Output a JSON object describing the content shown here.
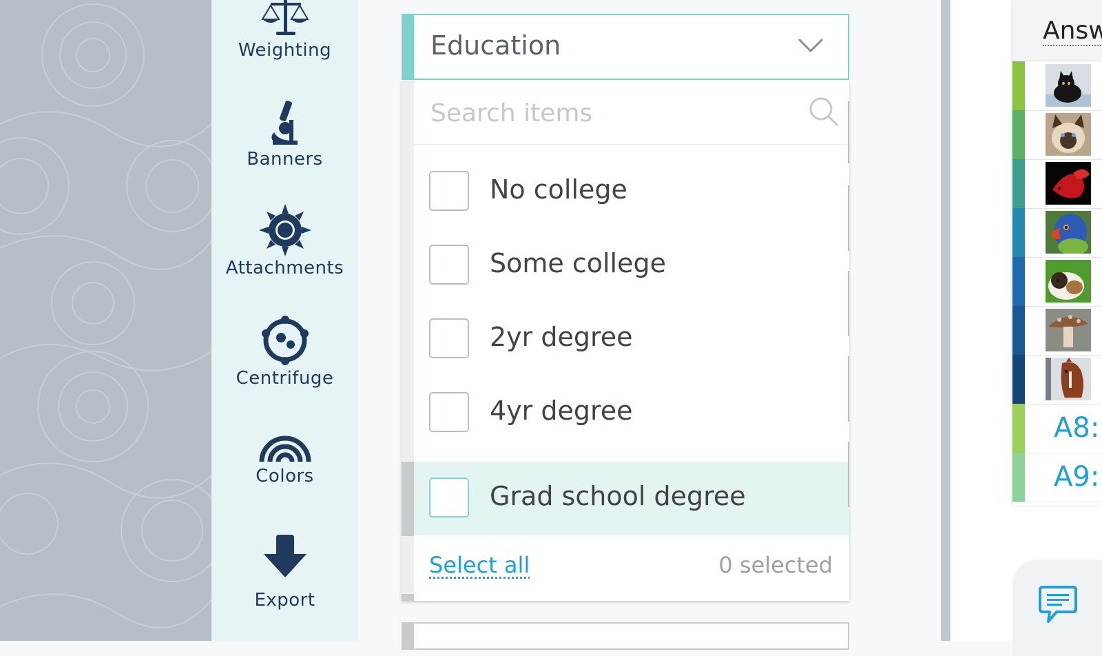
{
  "sidebar": {
    "items": [
      {
        "id": "weighting",
        "label": "Weighting",
        "icon": "scales-icon"
      },
      {
        "id": "banners",
        "label": "Banners",
        "icon": "microscope-icon"
      },
      {
        "id": "attachments",
        "label": "Attachments",
        "icon": "sun-icon"
      },
      {
        "id": "centrifuge",
        "label": "Centrifuge",
        "icon": "centrifuge-icon"
      },
      {
        "id": "colors",
        "label": "Colors",
        "icon": "rainbow-icon"
      },
      {
        "id": "export",
        "label": "Export",
        "icon": "arrow-down-icon"
      }
    ]
  },
  "dropdown": {
    "title": "Education",
    "search_placeholder": "Search items",
    "options": [
      {
        "label": "No college",
        "checked": false
      },
      {
        "label": "Some college",
        "checked": false
      },
      {
        "label": "2yr degree",
        "checked": false
      },
      {
        "label": "4yr degree",
        "checked": false
      },
      {
        "label": "Grad school degree",
        "checked": false,
        "highlighted": true
      }
    ],
    "select_all_label": "Select all",
    "selected_count": "0 selected"
  },
  "answers": {
    "title": "Answ",
    "rows": [
      {
        "type": "image",
        "subject": "black cat",
        "color": "#8cc43f"
      },
      {
        "type": "image",
        "subject": "siamese cat",
        "color": "#5bb068"
      },
      {
        "type": "image",
        "subject": "red betta fish",
        "color": "#3ea08c"
      },
      {
        "type": "image",
        "subject": "parrot",
        "color": "#2687b0"
      },
      {
        "type": "image",
        "subject": "guinea pig",
        "color": "#1e6ab0"
      },
      {
        "type": "image",
        "subject": "mushroom",
        "color": "#1a5894"
      },
      {
        "type": "image",
        "subject": "horse",
        "color": "#15467a"
      },
      {
        "type": "text",
        "label": "A8:",
        "color": "#9dd05a"
      },
      {
        "type": "text",
        "label": "A9:",
        "color": "#8ed19a"
      }
    ]
  },
  "colors": {
    "accent": "#7fd1d0",
    "link": "#1ea0d8",
    "icon": "#1f3a5c"
  },
  "chat": {
    "icon": "chat-bubble-icon"
  }
}
